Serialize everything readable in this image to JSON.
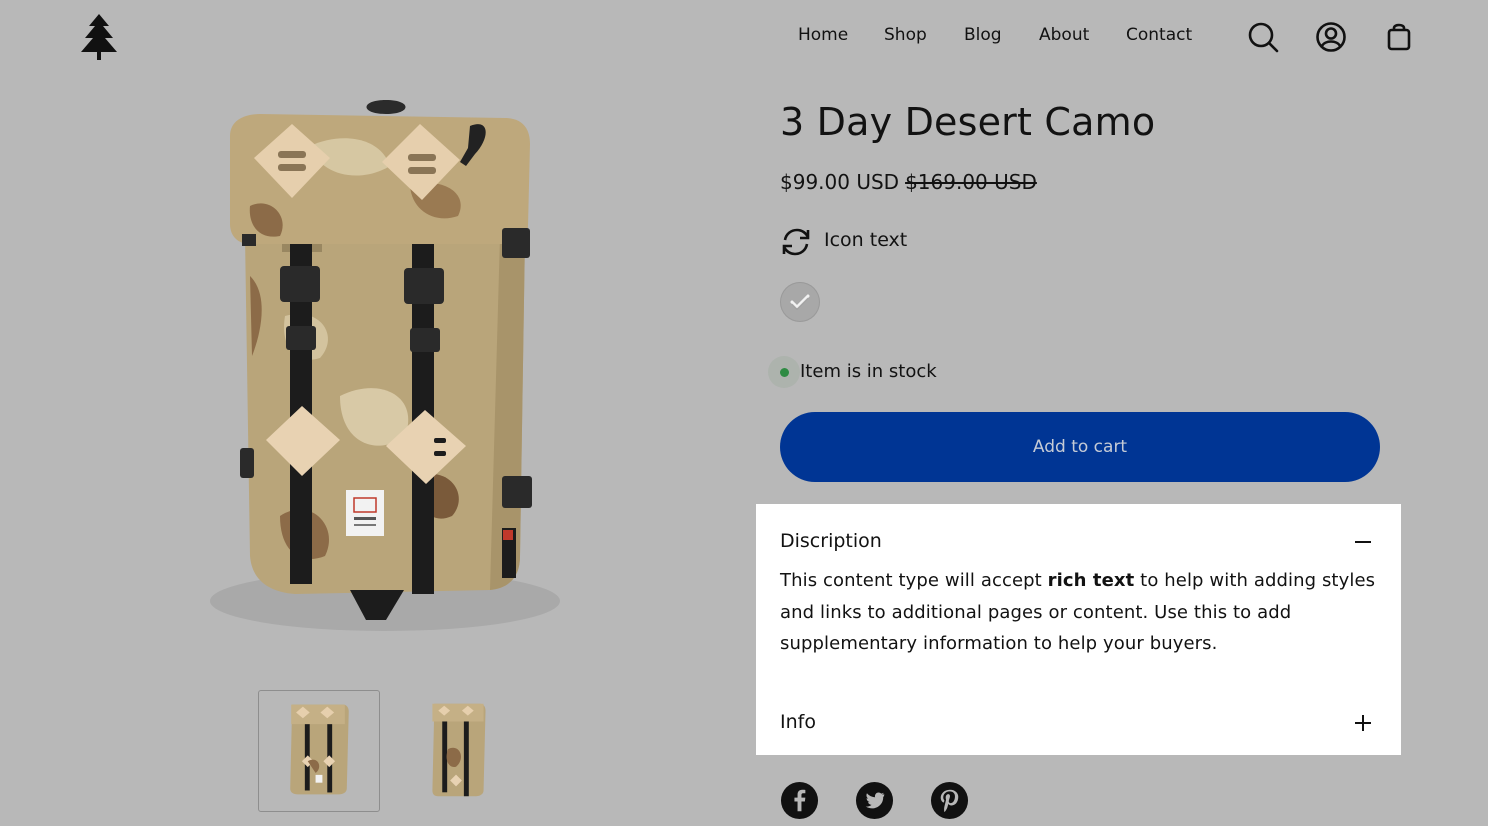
{
  "header": {
    "nav": [
      "Home",
      "Shop",
      "Blog",
      "About",
      "Contact"
    ],
    "icons": [
      "search-icon",
      "account-icon",
      "cart-icon"
    ]
  },
  "product": {
    "title": "3 Day Desert Camo",
    "price": "$99.00 USD",
    "compare_price": "$169.00 USD",
    "icon_text": "Icon text",
    "stock_text": "Item is in stock",
    "add_to_cart": "Add to cart"
  },
  "accordion": {
    "description_label": "Discription",
    "description_before": "This content type will accept ",
    "description_bold": "rich text",
    "description_after": " to help with adding styles and links to additional pages or content. Use this to add supplementary information to help your buyers.",
    "info_label": "Info"
  },
  "share": [
    "facebook-icon",
    "twitter-icon",
    "pinterest-icon"
  ],
  "colors": {
    "overlay_bg": "#b8b8b8",
    "button": "#003594",
    "stock_dot": "#2e8b43",
    "panel": "#ffffff"
  }
}
